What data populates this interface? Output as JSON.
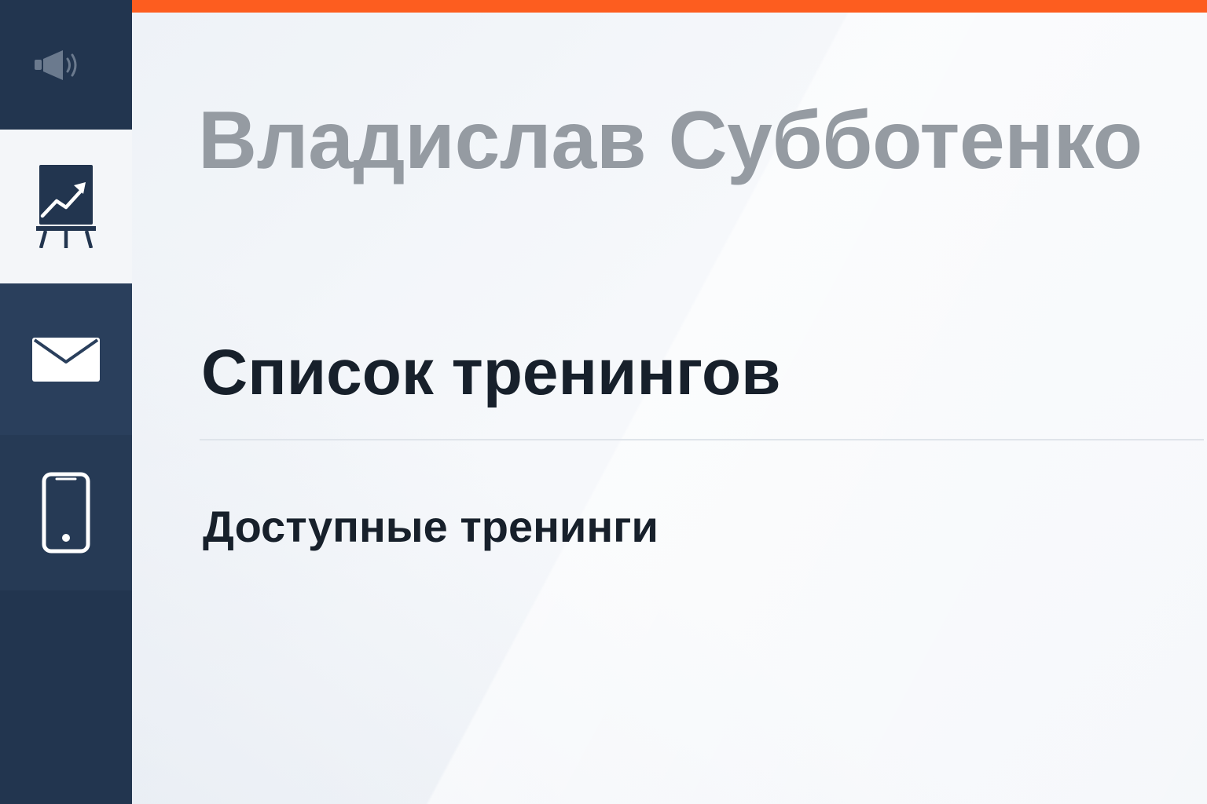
{
  "user": {
    "name": "Владислав Субботенко"
  },
  "main": {
    "page_title": "Список тренингов",
    "section_title": "Доступные тренинги"
  },
  "sidebar": {
    "items": [
      {
        "icon": "megaphone-icon",
        "active": false
      },
      {
        "icon": "presentation-chart-icon",
        "active": true
      },
      {
        "icon": "envelope-icon",
        "active": false
      },
      {
        "icon": "smartphone-icon",
        "active": false
      }
    ]
  },
  "colors": {
    "accent": "#fd5d1f",
    "sidebar": "#22354f",
    "active_item": "#f4f6f9",
    "title_text": "#17202b",
    "name_text": "#959ba2"
  }
}
